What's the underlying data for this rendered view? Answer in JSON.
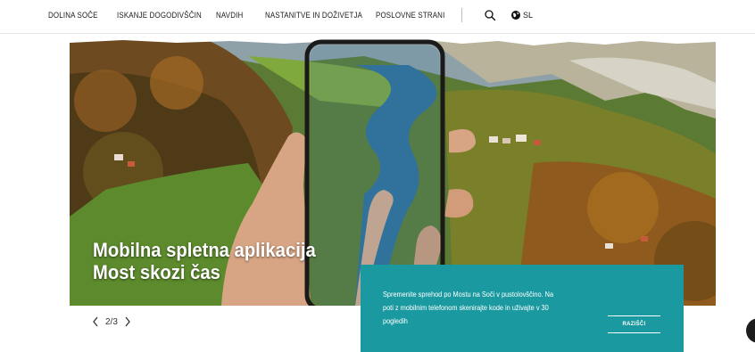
{
  "nav": {
    "items": [
      {
        "label": "DOLINA SOČE"
      },
      {
        "label": "ISKANJE DOGODIVŠČIN"
      },
      {
        "label": "NAVDIH"
      },
      {
        "label": "NASTANITVE IN DOŽIVETJA"
      },
      {
        "label": "POSLOVNE STRANI"
      }
    ],
    "search_icon": "search-icon",
    "language_icon": "globe-icon",
    "language": "SL"
  },
  "hero": {
    "title_line1": "Mobilna spletna aplikacija",
    "title_line2": "Most skozi čas"
  },
  "pager": {
    "text": "2/3",
    "prev_icon": "chevron-left-icon",
    "next_icon": "chevron-right-icon"
  },
  "card": {
    "text": "Spremenite sprehod po Mostu na Soči v pustolovščino. Na poti z mobilnim telefonom skenirajte kode in uživajte v 30 pogledih",
    "button": "RAZIŠČI",
    "background": "#1a9aa0"
  }
}
